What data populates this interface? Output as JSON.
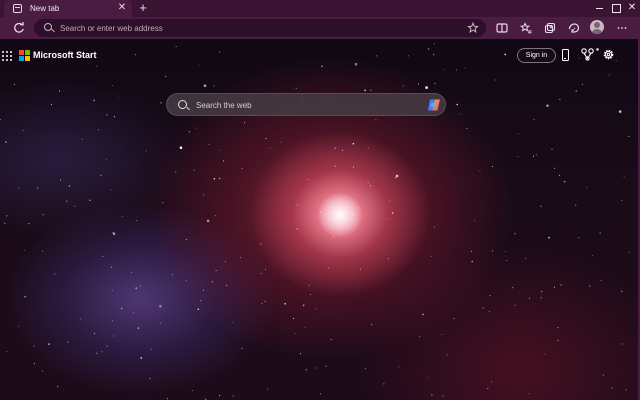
{
  "browser": {
    "tab": {
      "title": "New tab"
    },
    "address_bar": {
      "placeholder": "Search or enter web address"
    },
    "toolbar_icons": [
      "refresh-icon",
      "star-icon",
      "split-screen-icon",
      "favorites-icon",
      "collections-icon",
      "extensions-icon",
      "profile-avatar",
      "more-icon"
    ],
    "window_controls": [
      "minimize-icon",
      "maximize-icon",
      "close-icon"
    ]
  },
  "page": {
    "brand": "Microsoft Start",
    "sign_in_label": "Sign in",
    "search": {
      "placeholder": "Search the web"
    },
    "header_icons": [
      "apps-launcher-icon",
      "mobile-icon",
      "rewards-icon",
      "settings-icon"
    ]
  },
  "colors": {
    "frame": "#4a1c42",
    "tabstrip": "#3a1432",
    "address_bg": "#2c0f28",
    "ms_red": "#f25022",
    "ms_green": "#7fba00",
    "ms_blue": "#00a4ef",
    "ms_yellow": "#ffb900"
  }
}
